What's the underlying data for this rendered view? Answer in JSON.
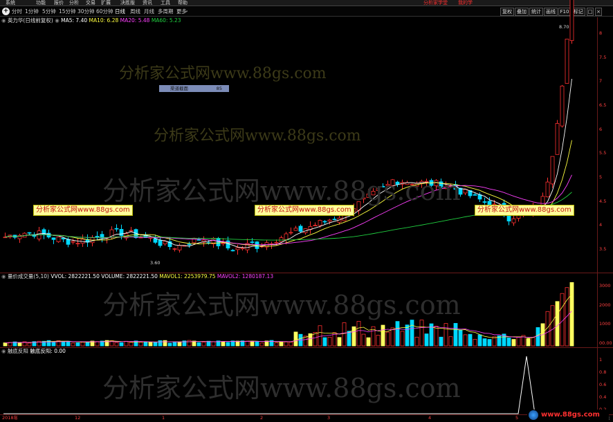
{
  "menu": {
    "items": [
      "系统",
      "功能",
      "报价",
      "分析",
      "交易",
      "扩展",
      "决胜版",
      "资讯",
      "工具",
      "帮助"
    ],
    "right_links": [
      "分析家学堂",
      "我的学"
    ]
  },
  "toolbar": {
    "periods": [
      "分时",
      "1分钟",
      "5分钟",
      "15分钟",
      "30分钟",
      "60分钟",
      "日线",
      "周线",
      "月线",
      "多周期",
      "更多"
    ],
    "active_period": "日线",
    "buttons": [
      "复权",
      "叠加",
      "统计",
      "画线",
      "F10",
      "标记"
    ]
  },
  "main_panel": {
    "stock_title": "英力华(日线前复权)",
    "ma5_label": "MA5: 7.40",
    "ma10_label": "MA10: 6.28",
    "ma20_label": "MA20: 5.48",
    "ma60_label": "MA60: 5.23",
    "high_marker": "8.70",
    "low_marker": "3.60",
    "tip_label": "渠道截面",
    "tip_value": "85",
    "y_ticks": [
      "8",
      "7.5",
      "7",
      "6.5",
      "6",
      "5.5",
      "5",
      "4.5",
      "4",
      "3.5"
    ],
    "colors": {
      "up": "#ff3030",
      "down": "#00d8ff",
      "ma5": "#ffffff",
      "ma10": "#ffff40",
      "ma20": "#ff40ff",
      "ma60": "#20d040"
    }
  },
  "volume_panel": {
    "title": "量价成交量(5,10)",
    "vvol": "VVOL: 2822221.50",
    "volume": "VOLUME: 2822221.50",
    "mavol1": "MAVOL1: 2253979.75",
    "mavol2": "MAVOL2: 1280187.13",
    "y_ticks": [
      "3000",
      "2000",
      "1000",
      "00.00"
    ]
  },
  "indicator_panel": {
    "title": "触底反阳",
    "value_label": "触底反阳: 0.00",
    "y_ticks": [
      "1",
      "0.8",
      "0.6",
      "0.4",
      "0.2"
    ]
  },
  "date_axis": {
    "labels": [
      "2018年",
      "12",
      "1",
      "2",
      "3",
      "4",
      "5"
    ],
    "right_label": "日线"
  },
  "watermarks": {
    "text": "分析家公式网www.88gs.com",
    "box_text": "分析家公式网www.88gs.com",
    "bottom_logo": "www.88gs.com"
  }
}
